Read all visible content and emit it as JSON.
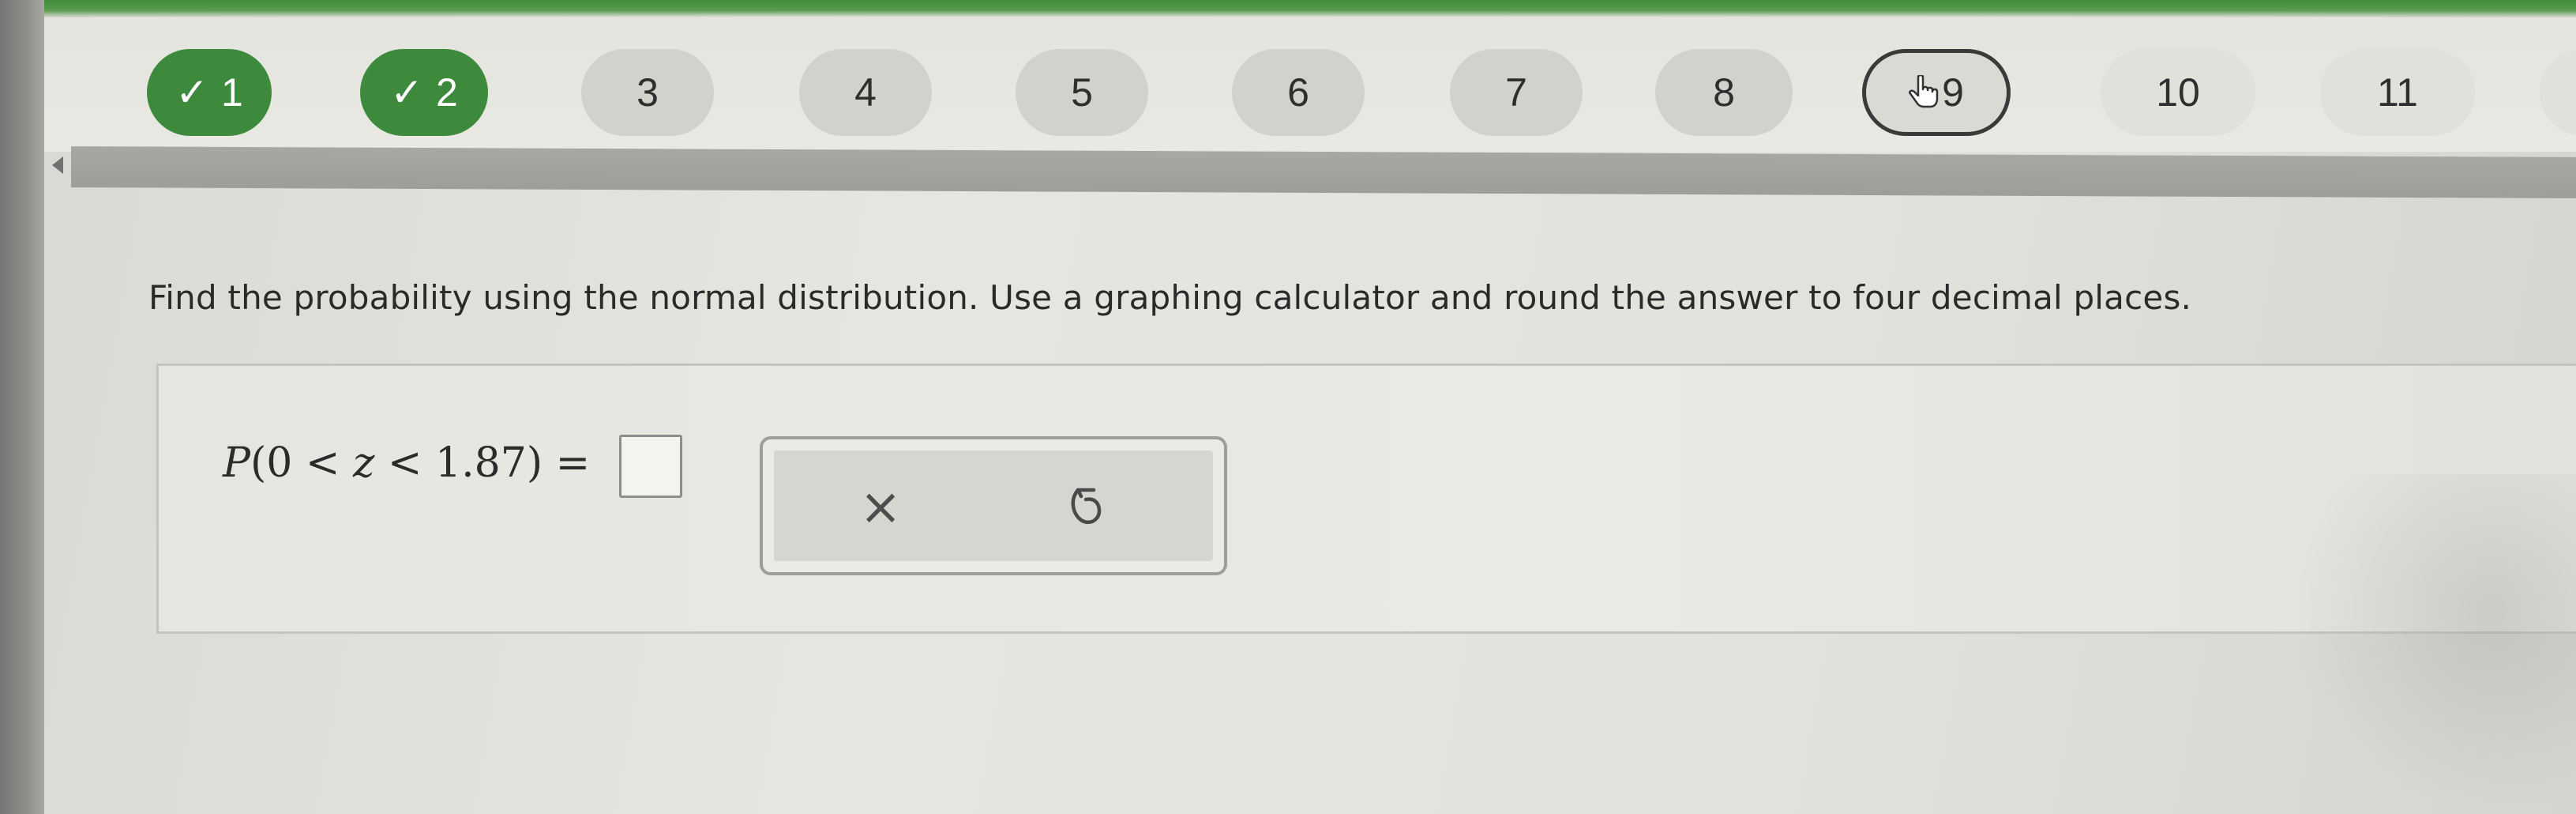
{
  "nav": {
    "steps": [
      {
        "label": "1",
        "status": "done"
      },
      {
        "label": "2",
        "status": "done"
      },
      {
        "label": "3",
        "status": "unanswered"
      },
      {
        "label": "4",
        "status": "unanswered"
      },
      {
        "label": "5",
        "status": "unanswered"
      },
      {
        "label": "6",
        "status": "unanswered"
      },
      {
        "label": "7",
        "status": "unanswered"
      },
      {
        "label": "8",
        "status": "unanswered"
      },
      {
        "label": "9",
        "status": "current"
      },
      {
        "label": "10",
        "status": "unanswered"
      },
      {
        "label": "11",
        "status": "unanswered"
      }
    ],
    "check_glyph": "✓",
    "done_color": "#3e8a3c",
    "left_arrow_icon": "left-triangle-icon",
    "current_cursor_icon": "hand-pointer-icon"
  },
  "question": {
    "prompt": "Find the probability using the normal distribution. Use a graphing calculator and round the answer to four decimal places."
  },
  "answer": {
    "lhs_func": "P",
    "lhs_open": "(0 < ",
    "lhs_var": "z",
    "lhs_close": " < 1.87) =",
    "input_value": "",
    "tools": {
      "clear_label": "×",
      "clear_icon": "x-icon",
      "undo_icon": "undo-arrow-icon"
    }
  }
}
